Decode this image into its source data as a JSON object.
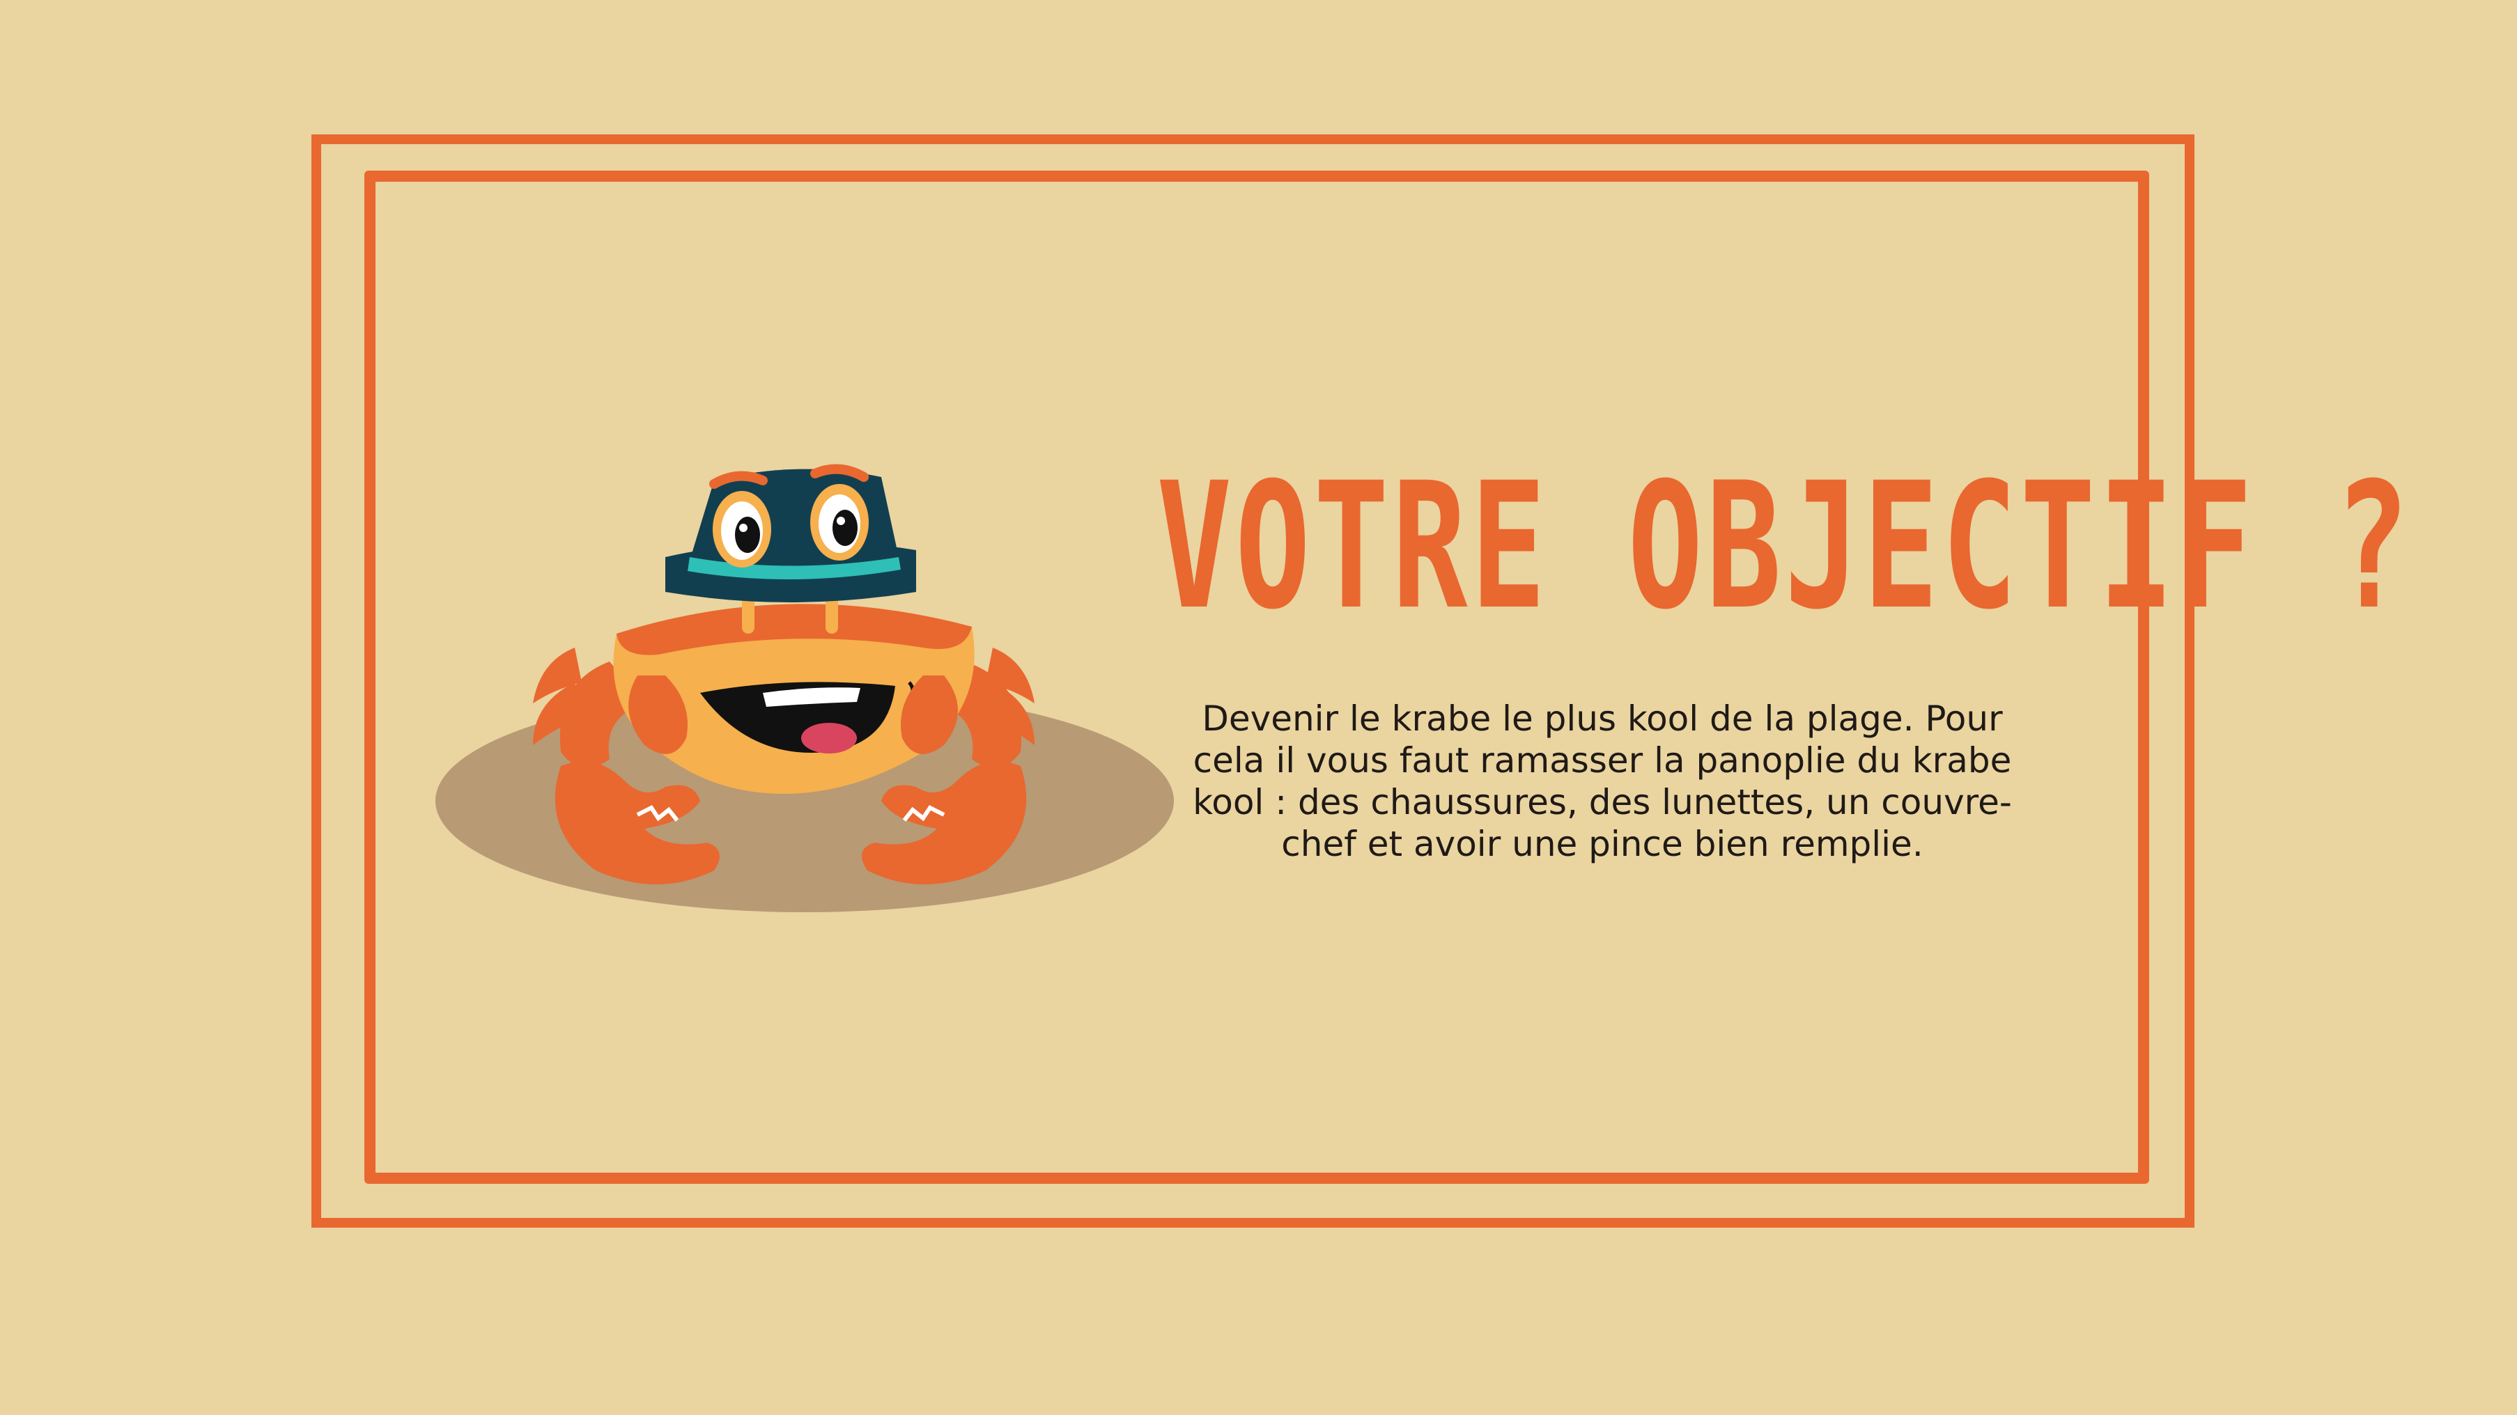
{
  "screen": {
    "title": "VOTRE OBJECTIF ?",
    "description": "Devenir le krabe le plus kool de la plage. Pour cela il vous faut ramasser la panoplie du krabe kool : des chaussures, des lunettes, un couvre-chef et avoir une pince bien remplie."
  },
  "mascot": {
    "icon": "crab-mascot-icon"
  },
  "colors": {
    "background": "#ead4a0",
    "accent": "#e86830",
    "text": "#1f1a16",
    "shadow": "#b89a74",
    "hat": "#123f50",
    "hat_band": "#2ebfb6",
    "shell": "#f6b04d"
  }
}
